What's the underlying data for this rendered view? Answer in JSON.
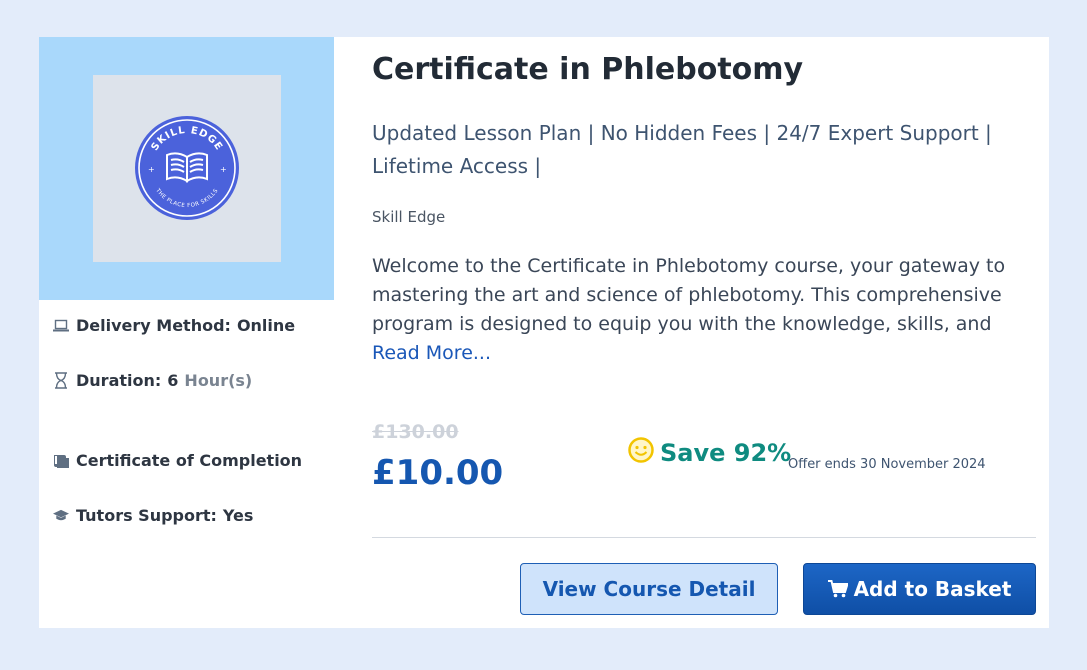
{
  "course": {
    "title": "Certificate in Phlebotomy",
    "tagline": "Updated Lesson Plan | No Hidden Fees | 24/7 Expert Support | Lifetime Access |",
    "provider": "Skill Edge",
    "description": "Welcome to the Certificate in Phlebotomy course, your gateway to mastering the art and science of phlebotomy. This comprehensive program is designed to equip you with the knowledge, skills, and",
    "read_more": "Read More..."
  },
  "logo": {
    "top_text": "SKILL EDGE",
    "bottom_text": "THE PLACE FOR SKILLS",
    "color": "#4b62db"
  },
  "meta": {
    "delivery_label": "Delivery Method:",
    "delivery_value": "Online",
    "duration_label": "Duration:",
    "duration_value": "6",
    "duration_unit": "Hour(s)",
    "certificate_label": "Certificate of Completion",
    "tutors_label": "Tutors Support:",
    "tutors_value": "Yes"
  },
  "pricing": {
    "old_price": "£130.00",
    "price": "£10.00",
    "save_text": "Save 92%",
    "offer_text": "Offer ends 30 November 2024"
  },
  "actions": {
    "view_detail": "View Course Detail",
    "add_to_basket": "Add to Basket"
  },
  "icons": {
    "delivery": "laptop-icon",
    "duration": "hourglass-icon",
    "certificate": "certificate-icon",
    "tutors": "graduation-cap-icon",
    "save": "smiley-icon",
    "cart": "cart-icon"
  },
  "colors": {
    "background": "#e3ecfa",
    "thumb_bg": "#a9d8fb",
    "price": "#1557b0",
    "save": "#0f8b80",
    "button_primary": "#1557b0"
  }
}
